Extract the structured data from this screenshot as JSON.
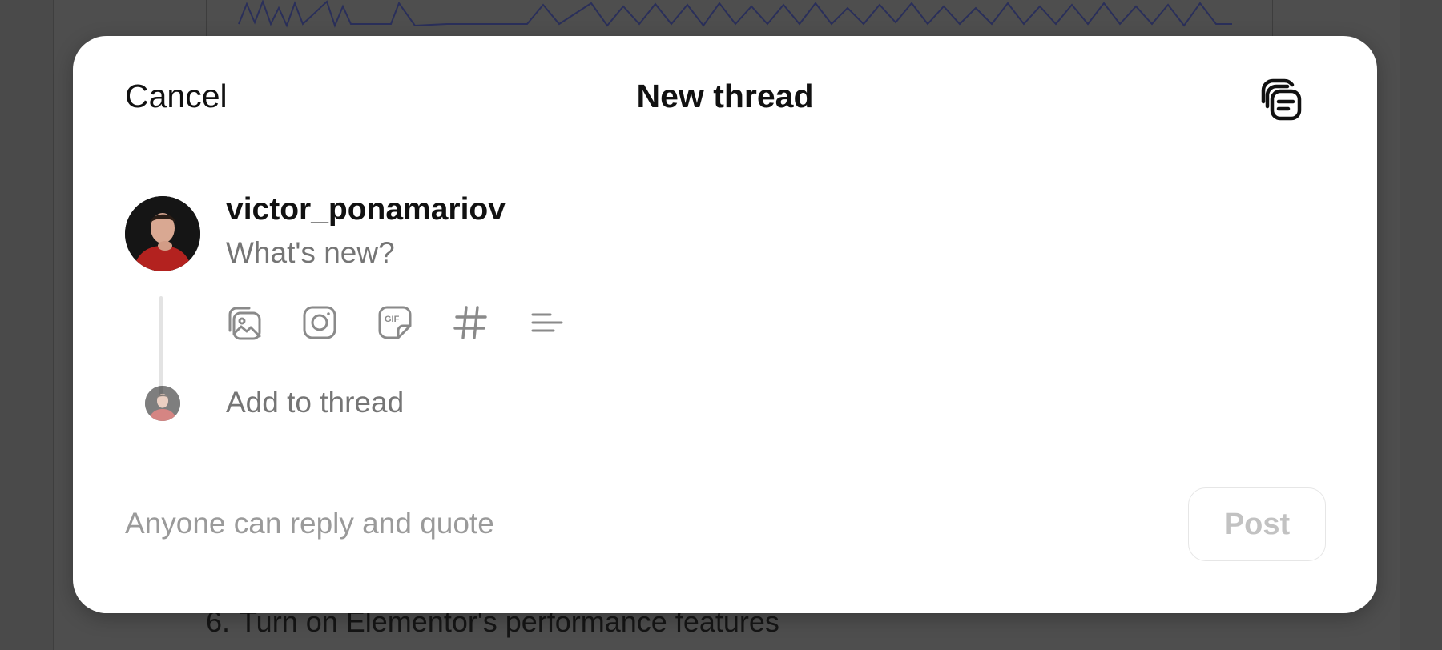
{
  "background": {
    "list_item_number": "6.",
    "list_item_text": "Turn on Elementor's performance features"
  },
  "modal": {
    "cancel_label": "Cancel",
    "title": "New thread",
    "drafts_icon": "drafts-icon",
    "username": "victor_ponamariov",
    "post_placeholder": "What's new?",
    "tools": [
      {
        "name": "image-gallery-icon"
      },
      {
        "name": "camera-icon"
      },
      {
        "name": "gif-icon"
      },
      {
        "name": "hashtag-icon"
      },
      {
        "name": "poll-icon"
      }
    ],
    "add_to_thread_placeholder": "Add to thread",
    "reply_setting": "Anyone can reply and quote",
    "post_label": "Post"
  },
  "colors": {
    "overlay": "#4a4a4a",
    "text_primary": "#111111",
    "text_muted": "#9a9a9a",
    "post_disabled": "#c2c2c2"
  }
}
